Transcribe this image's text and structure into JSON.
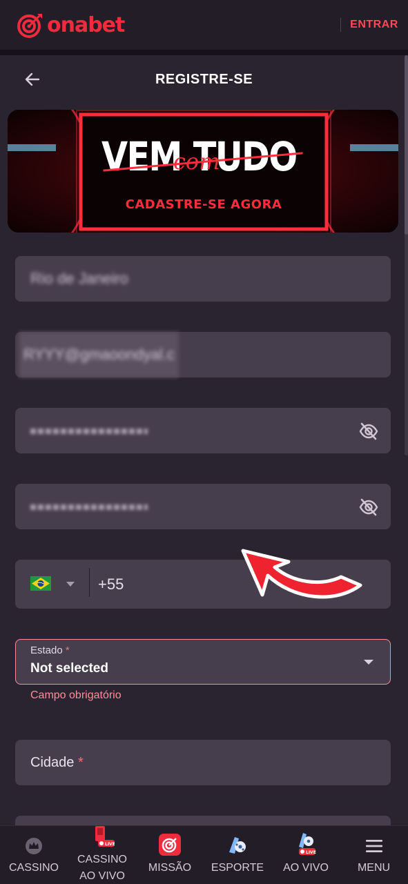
{
  "header": {
    "brand": "onabet",
    "login_label": "ENTRAR"
  },
  "page": {
    "title": "REGISTRE-SE"
  },
  "banner": {
    "headline_left": "VEM",
    "headline_right": "TUDO",
    "script_word": "com",
    "subline": "CADASTRE-SE AGORA"
  },
  "form": {
    "city_name_value": "Rio de Janeiro",
    "email_value": "RYYY@gmaoondyal.c",
    "password_masked": "••••••••••",
    "confirm_password_masked": "••••••••••",
    "phone_code": "+55",
    "state": {
      "label": "Estado",
      "required_mark": "*",
      "value": "Not selected",
      "error": "Campo obrigatório"
    },
    "city": {
      "label": "Cidade",
      "required_mark": "*"
    }
  },
  "nav": {
    "cassino": "CASSINO",
    "cassino_ao_vivo_1": "CASSINO",
    "cassino_ao_vivo_2": "AO VIVO",
    "missao": "MISSÃO",
    "esporte": "ESPORTE",
    "ao_vivo": "AO VIVO",
    "menu": "MENU",
    "live_badge": "LIVE"
  },
  "colors": {
    "accent": "#ef2c3d",
    "background": "#2a2430",
    "field": "#473e4d",
    "error": "#ff8e98"
  }
}
